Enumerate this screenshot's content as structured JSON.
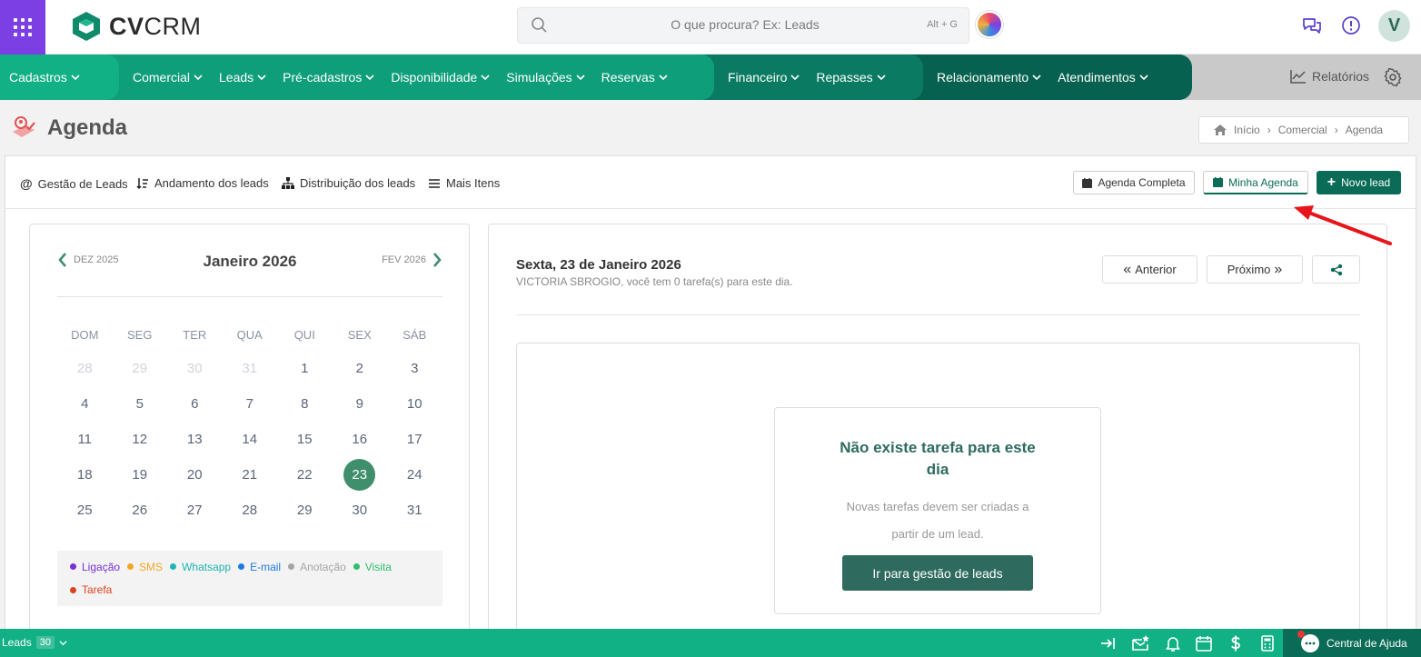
{
  "topbar": {
    "logo_bold": "CV",
    "logo_thin": "CRM",
    "search_placeholder": "O que procura? Ex: Leads",
    "search_shortcut": "Alt + G",
    "user_initial": "V",
    "icons": [
      "apps-grid-icon",
      "search-icon",
      "chat-icon",
      "info-icon"
    ]
  },
  "nav": {
    "group1": [
      "Cadastros"
    ],
    "group2": [
      "Comercial",
      "Leads",
      "Pré-cadastros",
      "Disponibilidade",
      "Simulações",
      "Reservas"
    ],
    "group3": [
      "Financeiro",
      "Repasses"
    ],
    "group4": [
      "Relacionamento",
      "Atendimentos"
    ],
    "reports": "Relatórios",
    "colors": {
      "g1": "#12b085",
      "g2": "#0f9e7a",
      "g3": "#0a7a62",
      "g4": "#076150"
    }
  },
  "page": {
    "title": "Agenda",
    "breadcrumb": [
      "Início",
      "Comercial",
      "Agenda"
    ]
  },
  "toolbar": {
    "links": [
      "Gestão de Leads",
      "Andamento dos leads",
      "Distribuição dos leads",
      "Mais Itens"
    ],
    "agenda_completa": "Agenda Completa",
    "minha_agenda": "Minha Agenda",
    "novo_lead": "Novo lead"
  },
  "calendar": {
    "prev_label": "DEZ 2025",
    "next_label": "FEV 2026",
    "month_title": "Janeiro 2026",
    "weekdays": [
      "DOM",
      "SEG",
      "TER",
      "QUA",
      "QUI",
      "SEX",
      "SÁB"
    ],
    "weeks": [
      [
        {
          "d": "28",
          "m": true
        },
        {
          "d": "29",
          "m": true
        },
        {
          "d": "30",
          "m": true
        },
        {
          "d": "31",
          "m": true
        },
        {
          "d": "1"
        },
        {
          "d": "2"
        },
        {
          "d": "3"
        }
      ],
      [
        {
          "d": "4"
        },
        {
          "d": "5"
        },
        {
          "d": "6"
        },
        {
          "d": "7"
        },
        {
          "d": "8"
        },
        {
          "d": "9"
        },
        {
          "d": "10"
        }
      ],
      [
        {
          "d": "11"
        },
        {
          "d": "12"
        },
        {
          "d": "13"
        },
        {
          "d": "14"
        },
        {
          "d": "15"
        },
        {
          "d": "16"
        },
        {
          "d": "17"
        }
      ],
      [
        {
          "d": "18"
        },
        {
          "d": "19"
        },
        {
          "d": "20"
        },
        {
          "d": "21"
        },
        {
          "d": "22"
        },
        {
          "d": "23",
          "sel": true
        },
        {
          "d": "24"
        }
      ],
      [
        {
          "d": "25"
        },
        {
          "d": "26"
        },
        {
          "d": "27"
        },
        {
          "d": "28"
        },
        {
          "d": "29"
        },
        {
          "d": "30"
        },
        {
          "d": "31"
        }
      ]
    ],
    "selected_day": "23",
    "legend": [
      {
        "label": "Ligação",
        "color": "#7b2fd6"
      },
      {
        "label": "SMS",
        "color": "#f5a623"
      },
      {
        "label": "Whatsapp",
        "color": "#20b5b5"
      },
      {
        "label": "E-mail",
        "color": "#1f7ae0"
      },
      {
        "label": "Anotação",
        "color": "#a5a5a5"
      },
      {
        "label": "Visita",
        "color": "#2fbf6b"
      },
      {
        "label": "Tarefa",
        "color": "#e0421e"
      }
    ]
  },
  "day": {
    "title": "Sexta, 23 de Janeiro 2026",
    "subtitle": "VICTORIA SBROGIO, você tem 0 tarefa(s) para este dia.",
    "prev": "Anterior",
    "next": "Próximo",
    "empty_title": "Não existe tarefa para este dia",
    "empty_text": "Novas tarefas devem ser criadas a partir de um lead.",
    "empty_button": "Ir para gestão de leads"
  },
  "bottombar": {
    "leads_label": "Leads",
    "leads_count": "30",
    "help": "Central de Ajuda"
  }
}
